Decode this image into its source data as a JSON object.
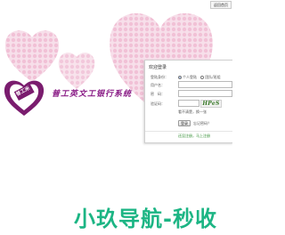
{
  "top_link": {
    "label": "返回首页"
  },
  "branding": {
    "logo_text": "普工米",
    "site_title": "普工英文工银行系统"
  },
  "login": {
    "title": "欢迎登录",
    "role_label": "登陆身份：",
    "role_options": [
      "个人登陆",
      "团队/班组"
    ],
    "role_selected": "个人登陆",
    "username_label": "用户名：",
    "username_value": "",
    "password_label": "密　码：",
    "password_value": "",
    "captcha_label": "验证码：",
    "captcha_value": "",
    "captcha_text": "HPeS",
    "captcha_hint": "看不清楚，换一张",
    "login_button": "登录",
    "forgot_password": "忘记密码？",
    "register_link": "还没注册，马上注册"
  },
  "watermark": {
    "text": "小玖导航-秒收"
  },
  "colors": {
    "heart_pink": "#f3c9dc",
    "logo_purple": "#7a1c6e",
    "title_purple": "#8a1d86",
    "watermark_green": "#1cb584"
  }
}
